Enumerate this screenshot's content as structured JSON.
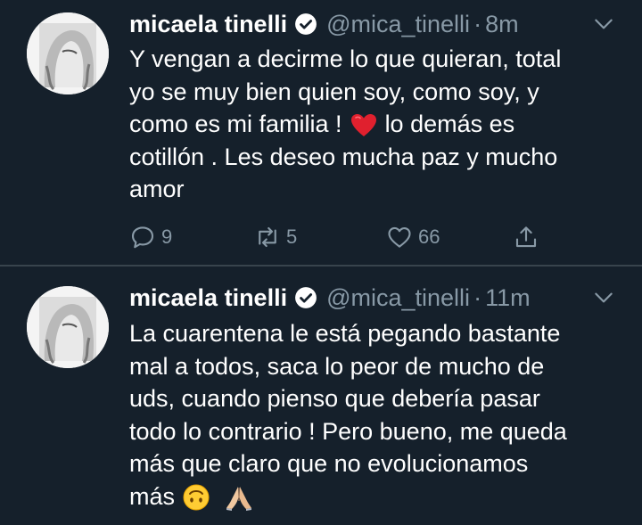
{
  "tweets": [
    {
      "author_name": "micaela tinelli",
      "handle": "@mica_tinelli",
      "separator": "·",
      "time": "8m",
      "lines": [
        "Y vengan a decirme lo que quieran, total",
        "yo se muy bien quien soy, como soy, y",
        "como es mi familia !",
        "lo demás es",
        "cotillón . Les deseo mucha paz y mucho",
        "amor"
      ],
      "replies": "9",
      "retweets": "5",
      "likes": "66"
    },
    {
      "author_name": "micaela tinelli",
      "handle": "@mica_tinelli",
      "separator": "·",
      "time": "11m",
      "lines": [
        "La cuarentena le está pegando bastante",
        "mal a todos, saca lo peor de mucho de",
        "uds, cuando pienso que debería pasar",
        "todo lo contrario ! Pero bueno, me queda",
        "más que claro que no evolucionamos",
        "más"
      ]
    }
  ],
  "icons": {
    "verified": "verified-badge-icon",
    "caret": "chevron-down-icon",
    "reply": "reply-icon",
    "retweet": "retweet-icon",
    "like": "heart-icon",
    "share": "share-icon",
    "heart_emoji": "red-heart-emoji",
    "upside_down_emoji": "upside-down-face-emoji",
    "pray_emoji": "folded-hands-emoji"
  },
  "colors": {
    "background": "#15202b",
    "text": "#ffffff",
    "muted": "#8899a6",
    "divider": "#38444d"
  }
}
